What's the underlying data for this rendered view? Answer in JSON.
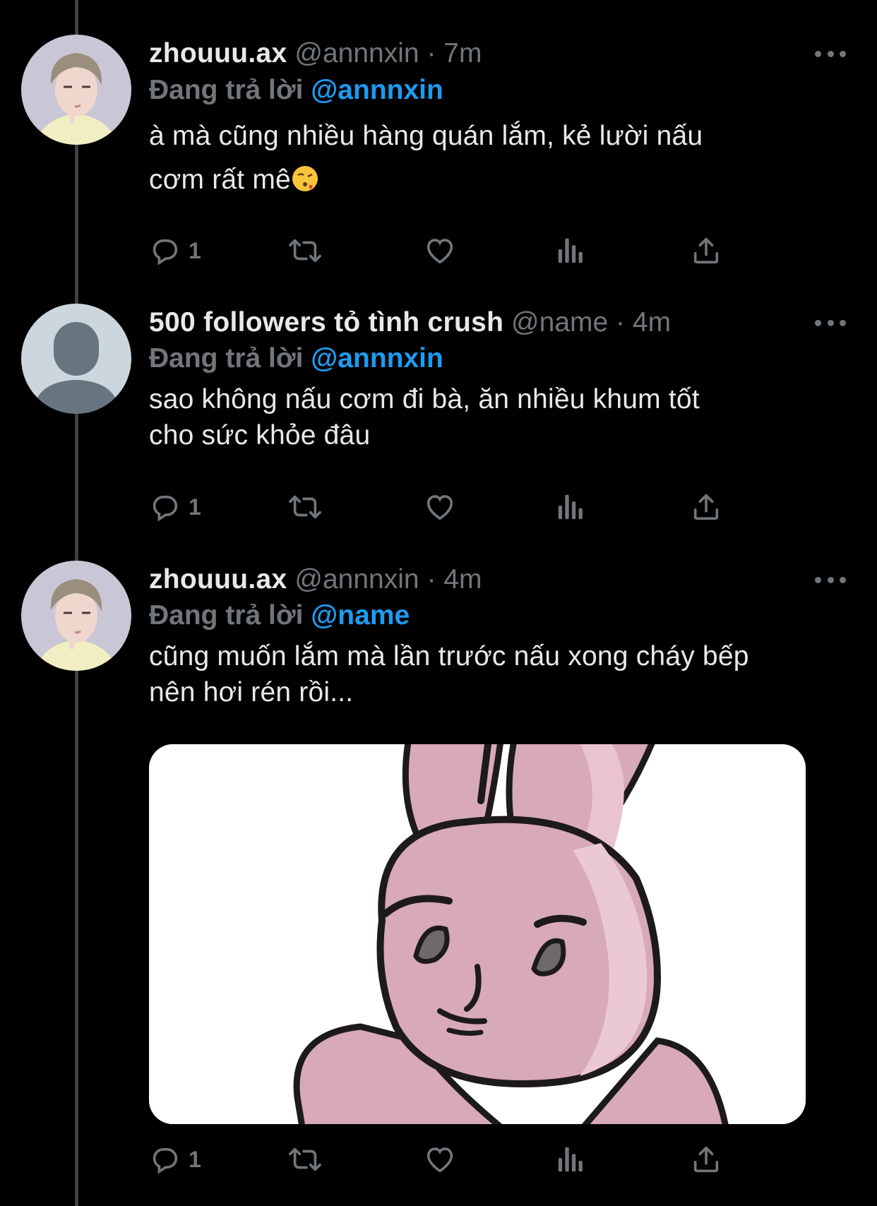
{
  "colors": {
    "background": "#000000",
    "text": "#e7e9ea",
    "muted": "#71767b",
    "link": "#1d9bf0",
    "thread": "#3e4144"
  },
  "tweets": [
    {
      "display_name": "zhouuu.ax",
      "handle": "@annnxin",
      "separator": "·",
      "time": "7m",
      "reply_label": "Đang trả lời",
      "reply_to": "@annnxin",
      "text_line1": "à mà cũng nhiều hàng quán lắm, kẻ lười nấu",
      "text_line2": "cơm rất mê",
      "emoji": "face-blowing-kiss-icon",
      "reply_count": "1"
    },
    {
      "display_name": "500 followers tỏ tình crush",
      "handle": "@name",
      "separator": "·",
      "time": "4m",
      "reply_label": "Đang trả lời",
      "reply_to": "@annnxin",
      "text_line1": "sao không nấu cơm đi bà, ăn nhiều khum tốt",
      "text_line2": "cho sức khỏe đâu",
      "reply_count": "1"
    },
    {
      "display_name": "zhouuu.ax",
      "handle": "@annnxin",
      "separator": "·",
      "time": "4m",
      "reply_label": "Đang trả lời",
      "reply_to": "@name",
      "text_line1": "cũng muốn lắm mà lần trước nấu xong cháy bếp",
      "text_line2": "nên hơi rén rồi...",
      "media": "pink-bunny-sticker",
      "reply_count": "1"
    }
  ],
  "icons": [
    "reply-icon",
    "retweet-icon",
    "like-icon",
    "views-icon",
    "share-icon",
    "more-icon"
  ]
}
